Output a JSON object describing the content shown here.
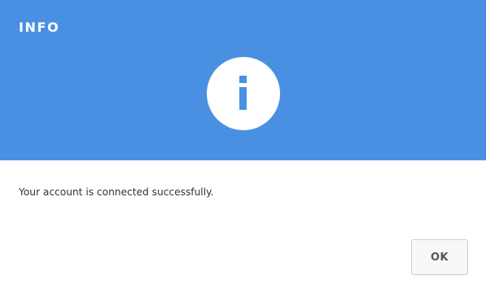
{
  "dialog": {
    "title": "INFO",
    "icon": "info-icon",
    "message": "Your account is connected successfully.",
    "ok_label": "OK"
  },
  "colors": {
    "header_background": "#4a90e2",
    "icon_circle": "#ffffff",
    "icon_glyph": "#4a90e2",
    "title_text": "#ffffff",
    "message_text": "#333333",
    "button_background": "#f8f8f8",
    "button_border": "#cccccc",
    "button_text": "#555555"
  }
}
